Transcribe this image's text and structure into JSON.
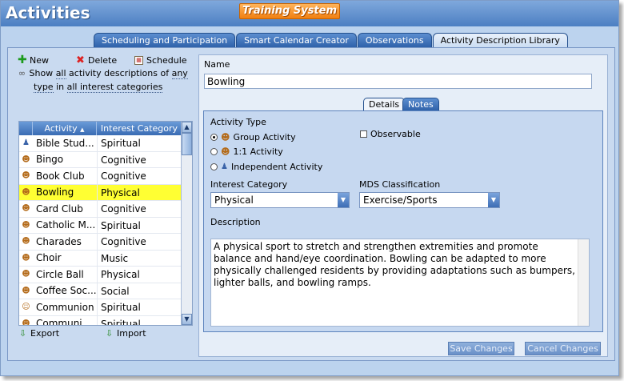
{
  "app": {
    "title": "Activities",
    "brand": "Training System"
  },
  "tabs": [
    {
      "label": "Scheduling and Participation"
    },
    {
      "label": "Smart Calendar Creator"
    },
    {
      "label": "Observations"
    },
    {
      "label": "Activity Description Library",
      "active": true
    }
  ],
  "toolbar": {
    "new_label": "New",
    "delete_label": "Delete",
    "schedule_label": "Schedule"
  },
  "filter": {
    "show": "Show",
    "scope": "all",
    "descriptions": "activity descriptions of",
    "any": "any",
    "type": "type",
    "in": "in",
    "categories": "all interest categories"
  },
  "grid": {
    "columns": [
      "Activity",
      "Interest Category"
    ],
    "rows": [
      {
        "icon": "person-icon",
        "activity": "Bible Stud...",
        "category": "Spiritual"
      },
      {
        "icon": "group-icon",
        "activity": "Bingo",
        "category": "Cognitive"
      },
      {
        "icon": "group-icon",
        "activity": "Book Club",
        "category": "Cognitive"
      },
      {
        "icon": "group-icon",
        "activity": "Bowling",
        "category": "Physical",
        "selected": true
      },
      {
        "icon": "group-icon",
        "activity": "Card Club",
        "category": "Cognitive"
      },
      {
        "icon": "group-icon",
        "activity": "Catholic M...",
        "category": "Spiritual"
      },
      {
        "icon": "group-icon",
        "activity": "Charades",
        "category": "Cognitive"
      },
      {
        "icon": "group-icon",
        "activity": "Choir",
        "category": "Music"
      },
      {
        "icon": "group-icon",
        "activity": "Circle Ball",
        "category": "Physical"
      },
      {
        "icon": "group-icon",
        "activity": "Coffee Soc...",
        "category": "Social"
      },
      {
        "icon": "one-to-one-icon",
        "activity": "Communion",
        "category": "Spiritual"
      },
      {
        "icon": "group-icon",
        "activity": "Communi...",
        "category": "Spiritual"
      }
    ]
  },
  "footer_left": {
    "export_label": "Export",
    "import_label": "Import"
  },
  "detail": {
    "name_label": "Name",
    "name_value": "Bowling",
    "subtabs": {
      "details": "Details",
      "notes": "Notes"
    },
    "activity_type_label": "Activity Type",
    "types": [
      "Group Activity",
      "1:1 Activity",
      "Independent Activity"
    ],
    "selected_type": "Group Activity",
    "observable_label": "Observable",
    "interest_category_label": "Interest Category",
    "interest_category_value": "Physical",
    "mds_label": "MDS Classification",
    "mds_value": "Exercise/Sports",
    "description_label": "Description",
    "description": "A physical sport to stretch and strengthen extremities and promote balance and hand/eye coordination. Bowling can be adapted to more physically challenged residents by providing adaptations such as bumpers, lighter balls, and bowling ramps."
  },
  "buttons": {
    "save": "Save Changes",
    "cancel": "Cancel Changes"
  },
  "colors": {
    "titlebar": "#4c7fc2",
    "brand": "#f07f10",
    "selection": "#ffff33",
    "tab_active": "#c9dcf2"
  }
}
